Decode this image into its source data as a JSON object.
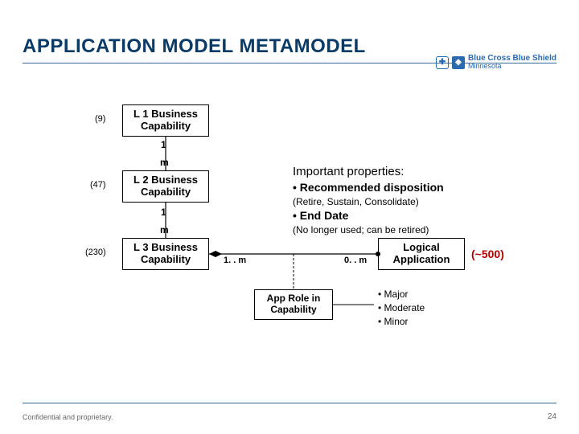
{
  "slide": {
    "title": "APPLICATION MODEL METAMODEL",
    "confidential": "Confidential and proprietary.",
    "page_number": "24"
  },
  "logo": {
    "brand_line1": "Blue Cross",
    "brand_line2": "Blue Shield",
    "region": "Minnesota"
  },
  "boxes": {
    "l1": {
      "label": "L 1 Business Capability",
      "count": "(9)"
    },
    "l2": {
      "label": "L 2 Business Capability",
      "count": "(47)"
    },
    "l3": {
      "label": "L 3 Business Capability",
      "count": "(230)"
    },
    "logical_app": {
      "label": "Logical Application",
      "count": "(~500)"
    },
    "app_role": {
      "label": "App Role in Capability"
    }
  },
  "cardinality": {
    "l1_bottom": "1",
    "l2_top": "m",
    "l2_bottom": "1",
    "l3_top": "m",
    "l3_right": "1. . m",
    "app_left": "0. . m"
  },
  "properties": {
    "heading": "Important properties:",
    "item1": "• Recommended disposition",
    "item1_sub": "(Retire, Sustain, Consolidate)",
    "item2": "• End Date",
    "item2_sub": "(No longer used; can be retired)"
  },
  "role_levels": {
    "a": "• Major",
    "b": "• Moderate",
    "c": "• Minor"
  }
}
